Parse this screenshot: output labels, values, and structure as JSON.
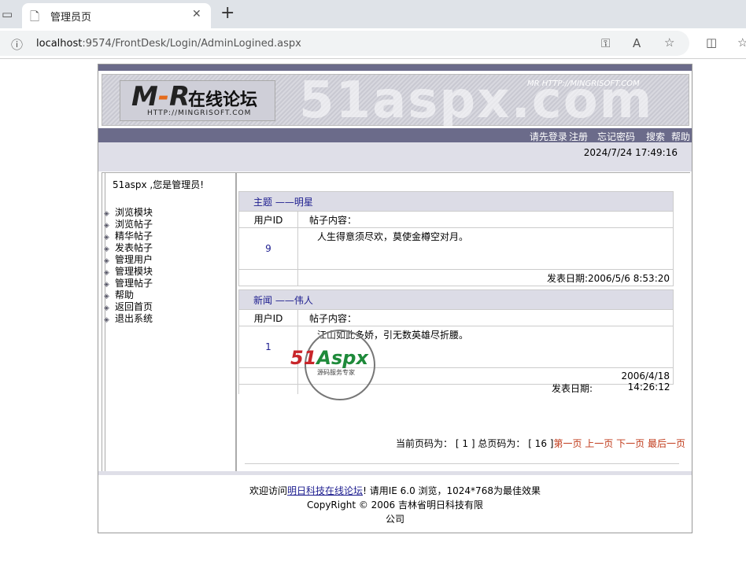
{
  "browser": {
    "tab_title": "管理员页",
    "new_tab": "+",
    "close": "✕",
    "url_host": "localhost",
    "url_path": ":9574/FrontDesk/Login/AdminLogined.aspx"
  },
  "banner": {
    "watermark": "51aspx.com",
    "logo_mr": "M",
    "logo_mr_dash": "-",
    "logo_mr_r": "R",
    "logo_cn": "在线论坛",
    "logo_url": "HTTP://MINGRISOFT.COM",
    "small": "MR HTTP://MINGRISOFT.COM"
  },
  "nav": [
    "请先登录",
    "注册",
    "忘记密码",
    "搜索",
    "帮助"
  ],
  "datetime": "2024/7/24 17:49:16",
  "sidebar": {
    "welcome": "51aspx ,您是管理员!",
    "items": [
      "浏览模块",
      "浏览帖子",
      "精华帖子",
      "发表帖子",
      "管理用户",
      "管理模块",
      "管理帖子",
      "帮助",
      "返回首页",
      "退出系统"
    ]
  },
  "posts": [
    {
      "topic": "主题 ——明星",
      "uid_label": "用户ID",
      "content_label": "帖子内容：",
      "uid": "9",
      "content": "人生得意须尽欢，莫使金樽空对月。",
      "date_label": "发表日期:",
      "date": "2006/5/6 8:53:20"
    },
    {
      "topic": "新闻 ——伟人",
      "uid_label": "用户ID",
      "content_label": "帖子内容：",
      "uid": "1",
      "content": "江山如此多娇，引无数英雄尽折腰。",
      "date_label": "发表日期:",
      "date_line1": "2006/4/18",
      "date_line2": "14:26:12"
    }
  ],
  "pager": {
    "current_label": "当前页码为：",
    "current": "[  1  ]",
    "total_label": "总页码为：",
    "total": "[ 16  ]",
    "first": "第一页",
    "prev": "上一页",
    "next": "下一页",
    "last": "最后一页"
  },
  "footer": {
    "pre": "欢迎访问",
    "link": "明日科技在线论坛",
    "post": "! 请用IE 6.0 浏览，1024*768为最佳效果",
    "copyright": "CopyRight © 2006 吉林省明日科技有限",
    "company_tail": "公司"
  },
  "stamp": {
    "brand_a": "51",
    "brand_b": "Aspx",
    "slogan": "源码服务专家"
  }
}
